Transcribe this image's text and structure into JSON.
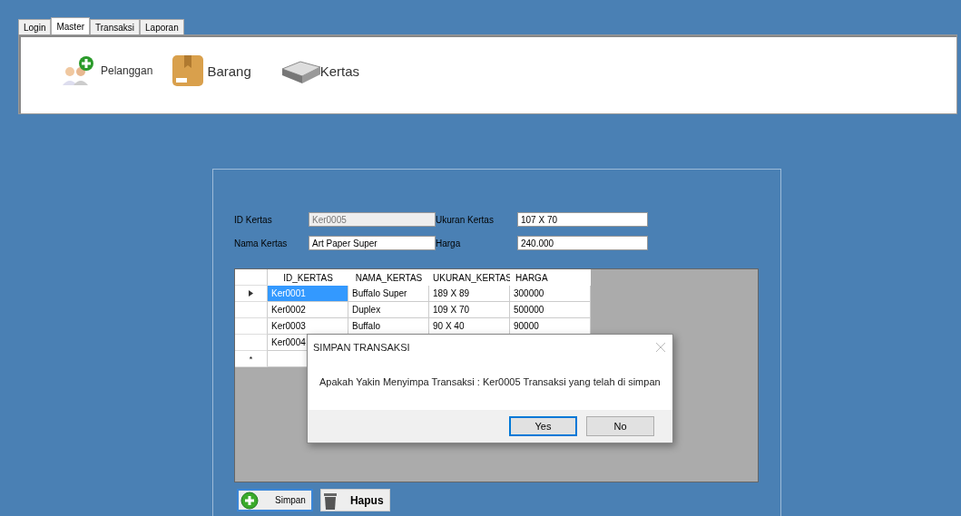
{
  "tabs": [
    {
      "label": "Login",
      "selected": false
    },
    {
      "label": "Master",
      "selected": true
    },
    {
      "label": "Transaksi",
      "selected": false
    },
    {
      "label": "Laporan",
      "selected": false
    }
  ],
  "ribbon": [
    {
      "kind": "people",
      "label": "Pelanggan"
    },
    {
      "kind": "box",
      "label": "Barang"
    },
    {
      "kind": "tray",
      "label": "Kertas"
    }
  ],
  "form": [
    {
      "label": "ID Kertas",
      "value": "Ker0005",
      "disabled": true
    },
    {
      "label": "Ukuran Kertas",
      "value": "107 X 70",
      "disabled": false
    },
    {
      "label": "Nama Kertas",
      "value": "Art Paper Super",
      "disabled": false
    },
    {
      "label": "Harga",
      "value": "240.000",
      "disabled": false
    }
  ],
  "table": {
    "columns": [
      "ID_KERTAS",
      "NAMA_KERTAS",
      "UKURAN_KERTAS",
      "HARGA"
    ],
    "rows": [
      {
        "cells": [
          "Ker0001",
          "Buffalo Super",
          "189 X 89",
          "300000"
        ],
        "selected": true
      },
      {
        "cells": [
          "Ker0002",
          "Duplex",
          "109 X 70",
          "500000"
        ],
        "selected": false
      },
      {
        "cells": [
          "Ker0003",
          "Buffalo",
          "90 X 40",
          "90000"
        ],
        "selected": false
      },
      {
        "cells": [
          "Ker0004"
        ],
        "selected": false
      }
    ],
    "new_row_marker": "*"
  },
  "dialog": {
    "title": "SIMPAN TRANSAKSI",
    "message": "Apakah Yakin Menyimpa Transaksi : Ker0005 Transaksi yang telah di simpan",
    "buttons": [
      {
        "label": "Yes",
        "selected": true
      },
      {
        "label": "No",
        "selected": false
      }
    ]
  },
  "actions": [
    {
      "kind": "add",
      "label": "Simpan",
      "selected": true
    },
    {
      "kind": "trash",
      "label": "Hapus",
      "selected": false
    }
  ]
}
